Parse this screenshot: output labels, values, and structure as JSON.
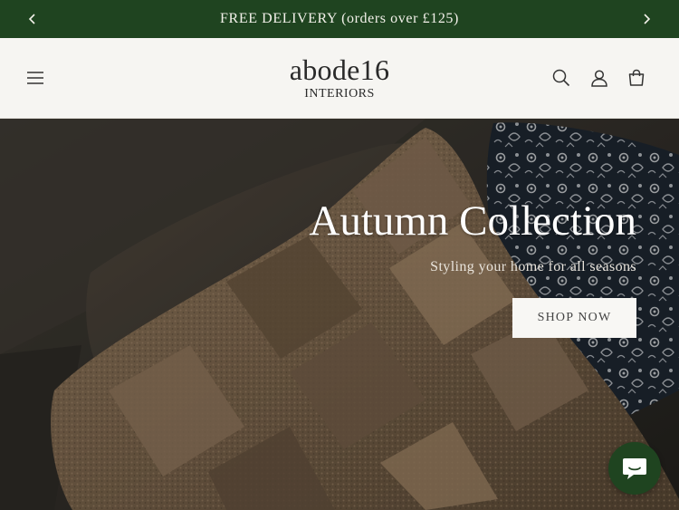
{
  "announcement": {
    "text": "FREE DELIVERY (orders over £125)",
    "prev_icon": "chevron-left-icon",
    "next_icon": "chevron-right-icon"
  },
  "header": {
    "logo_main": "abode16",
    "logo_sub": "INTERIORS",
    "icons": [
      "menu-icon",
      "search-icon",
      "account-icon",
      "cart-icon"
    ]
  },
  "hero": {
    "title": "Autumn Collection",
    "subtitle": "Styling your home for all seasons",
    "button_label": "SHOP NOW"
  },
  "chat": {
    "icon": "chat-icon"
  },
  "colors": {
    "brand_green": "#1f4420",
    "header_bg": "#f6f5f2",
    "button_bg": "#f8f7f4"
  }
}
